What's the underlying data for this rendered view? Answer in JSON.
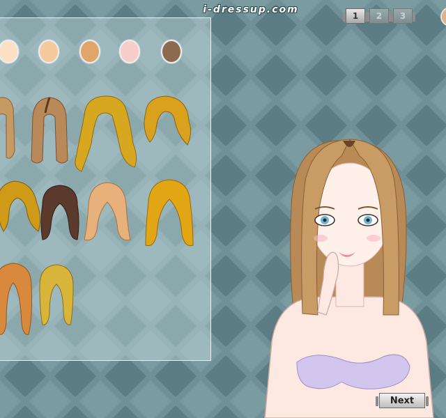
{
  "site": {
    "title": "i-dressup.com"
  },
  "pager": {
    "pages": [
      "1",
      "2",
      "3"
    ],
    "active": "1"
  },
  "skin_swatches": [
    {
      "name": "skin-tone-1",
      "color": "#fbe0c4"
    },
    {
      "name": "skin-tone-2",
      "color": "#f3c99e"
    },
    {
      "name": "skin-tone-3",
      "color": "#e0a56a"
    },
    {
      "name": "skin-tone-4",
      "color": "#f9cccc"
    },
    {
      "name": "skin-tone-5",
      "color": "#8c6a4e"
    }
  ],
  "hair_options": [
    {
      "name": "hair-light-brown-straight",
      "color": "#c89a63"
    },
    {
      "name": "hair-light-brown-long",
      "color": "#b9895a"
    },
    {
      "name": "hair-golden-wavy-long",
      "color": "#d7a81f"
    },
    {
      "name": "hair-golden-curly",
      "color": "#d9a11c"
    },
    {
      "name": "hair-golden-curly-2",
      "color": "#cf9a18"
    },
    {
      "name": "hair-dark-brown-wavy",
      "color": "#5b3a2b"
    },
    {
      "name": "hair-strawberry-blonde",
      "color": "#e8b07a"
    },
    {
      "name": "hair-golden-ringlets",
      "color": "#e2a615"
    },
    {
      "name": "hair-orange-bob",
      "color": "#d8893e"
    },
    {
      "name": "hair-golden-bob",
      "color": "#d9b43a"
    }
  ],
  "buttons": {
    "next": "Next"
  },
  "colors": {
    "background": "#6f9096",
    "diamond": "#5a7c82",
    "panel_border": "#e5eef0"
  }
}
